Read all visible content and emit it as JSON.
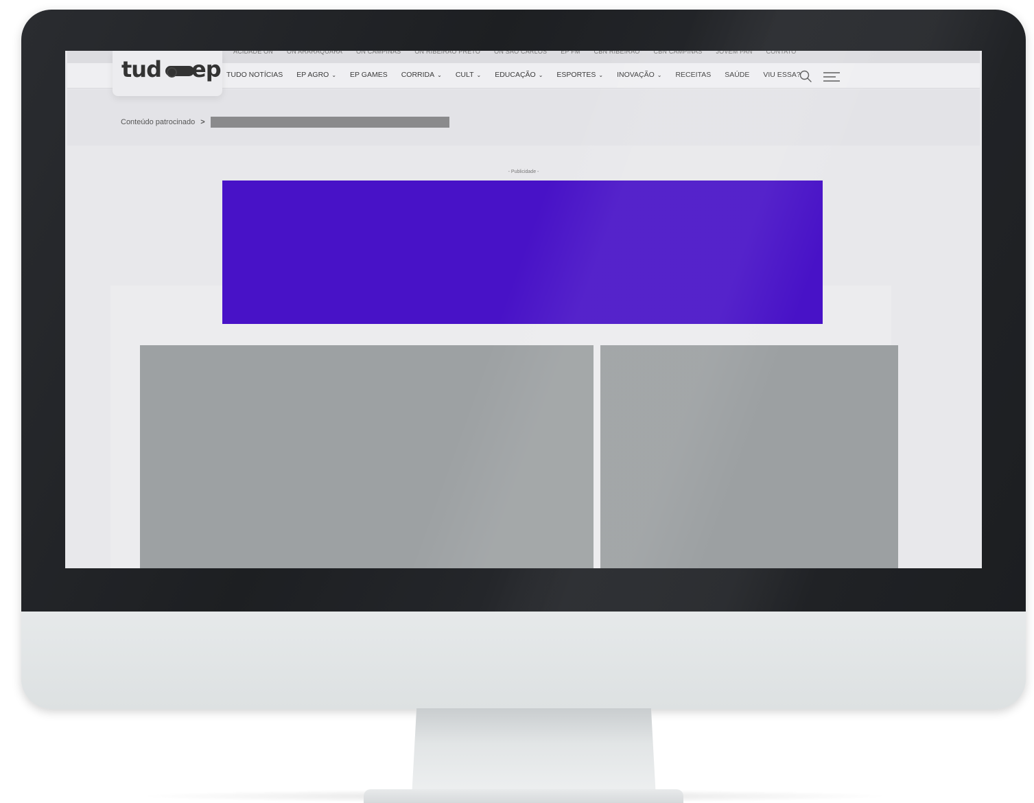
{
  "site": {
    "logo_left": "tud",
    "logo_right": "ep"
  },
  "top_links": [
    "ACIDADE ON",
    "ON ARARAQUARA",
    "ON CAMPINAS",
    "ON RIBEIRÃO PRETO",
    "ON SÃO CARLOS",
    "EP FM",
    "CBN RIBEIRÃO",
    "CBN CAMPINAS",
    "JOVEM PAN",
    "CONTATO"
  ],
  "nav": [
    {
      "label": "TUDO NOTÍCIAS",
      "chevron": ""
    },
    {
      "label": "EP AGRO",
      "chevron": "⌄"
    },
    {
      "label": "EP GAMES",
      "chevron": ""
    },
    {
      "label": "CORRIDA",
      "chevron": "⌄"
    },
    {
      "label": "CULT",
      "chevron": "⌄"
    },
    {
      "label": "EDUCAÇÃO",
      "chevron": "⌄"
    },
    {
      "label": "ESPORTES",
      "chevron": "⌄"
    },
    {
      "label": "INOVAÇÃO",
      "chevron": "⌄"
    },
    {
      "label": "RECEITAS",
      "chevron": ""
    },
    {
      "label": "SAÚDE",
      "chevron": ""
    },
    {
      "label": "VIU ESSA?",
      "chevron": ""
    }
  ],
  "icons": {
    "search": "search-icon",
    "menu": "hamburger-menu-icon"
  },
  "breadcrumb": {
    "label": "Conteúdo patrocinado",
    "separator": ">"
  },
  "ad": {
    "label": "- Publicidade -",
    "color": "#4812c7"
  },
  "colors": {
    "bezel": "#1f2124",
    "screen_bg": "#e8e8eb",
    "placeholder_image": "#9da1a3"
  }
}
